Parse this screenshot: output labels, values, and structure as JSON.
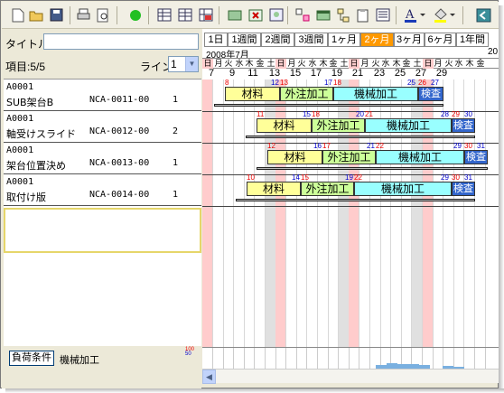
{
  "toolbar": {
    "icons": [
      "new-icon",
      "open-icon",
      "save-icon",
      "print-icon",
      "print-preview-icon",
      "run-icon",
      "layout-1-icon",
      "layout-2-icon",
      "layout-3-icon",
      "green-box-icon",
      "excel-icon",
      "image-icon",
      "sort-icon",
      "window-icon",
      "tree-icon",
      "clipboard-icon",
      "list-icon",
      "font-color-icon",
      "fill-color-icon",
      "exit-icon"
    ]
  },
  "left": {
    "title_label": "タイトル",
    "title_value": "",
    "items_label": "項目:5/5",
    "line_label": "ライン",
    "line_value": "1",
    "rows": [
      {
        "code": "A0001",
        "name": "SUB架台B",
        "part": "NCA-0011-00",
        "qty": "1"
      },
      {
        "code": "A0001",
        "name": "軸受けスライド",
        "part": "NCA-0012-00",
        "qty": "2"
      },
      {
        "code": "A0001",
        "name": "架台位置決め",
        "part": "NCA-0013-00",
        "qty": "1"
      },
      {
        "code": "A0001",
        "name": "取付け版",
        "part": "NCA-0014-00",
        "qty": "1"
      }
    ],
    "load_button": "負荷条件",
    "load_label": "機械加工",
    "scale_top": "100",
    "scale_bottom": "50"
  },
  "tabs": [
    "1日",
    "1週間",
    "2週間",
    "3週間",
    "1ヶ月",
    "2ヶ月",
    "3ヶ月",
    "6ヶ月",
    "1年間"
  ],
  "active_tab": "2ヶ月",
  "header": {
    "month": "2008年7月",
    "month_next": "20",
    "weekdays": [
      "日",
      "月",
      "火",
      "水",
      "木",
      "金",
      "土",
      "日",
      "月",
      "火",
      "水",
      "木",
      "金",
      "土",
      "日",
      "月",
      "火",
      "水",
      "木",
      "金",
      "土",
      "日",
      "月",
      "火",
      "水",
      "木",
      "金"
    ],
    "day_numbers": [
      "7",
      "9",
      "11",
      "13",
      "15",
      "17",
      "19",
      "21",
      "23",
      "25",
      "27",
      "29"
    ]
  },
  "bars": [
    {
      "material": "材料",
      "outsource": "外注加工",
      "machine": "機械加工",
      "inspect": "検査",
      "dates": [
        "8",
        "12",
        "13",
        "17",
        "18",
        "25",
        "26",
        "27"
      ]
    },
    {
      "material": "材料",
      "outsource": "外注加工",
      "machine": "機械加工",
      "inspect": "検査",
      "dates": [
        "11",
        "15",
        "18",
        "20",
        "21",
        "28",
        "29",
        "30"
      ]
    },
    {
      "material": "材料",
      "outsource": "外注加工",
      "machine": "機械加工",
      "inspect": "検査",
      "dates": [
        "12",
        "16",
        "17",
        "21",
        "22",
        "29",
        "30",
        "31"
      ]
    },
    {
      "material": "材料",
      "outsource": "外注加工",
      "machine": "機械加工",
      "inspect": "検査",
      "dates": [
        "10",
        "14",
        "15",
        "19",
        "22",
        "29",
        "30",
        "31"
      ]
    }
  ],
  "colors": {
    "accent": "#ff9900",
    "sunday": "#ffcccc",
    "saturday": "#e0e0e0",
    "material": "#ffff99",
    "outsource": "#ccff99",
    "machine": "#99ffff",
    "inspect": "#3366cc"
  }
}
